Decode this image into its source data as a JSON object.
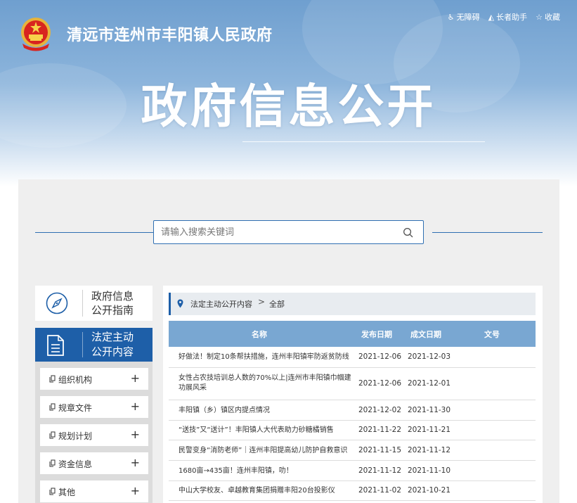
{
  "header": {
    "site_title": "清远市连州市丰阳镇人民政府",
    "links": [
      {
        "label": "无障碍",
        "icon": "accessibility-icon"
      },
      {
        "label": "长者助手",
        "icon": "elder-assistant-icon"
      },
      {
        "label": "收藏",
        "icon": "star-icon"
      }
    ],
    "banner_title": "政府信息公开"
  },
  "search": {
    "placeholder": "请输入搜索关键词",
    "icon": "search-icon"
  },
  "sidebar": {
    "guide": {
      "line1": "政府信息",
      "line2": "公开指南",
      "icon": "compass-icon"
    },
    "active": {
      "line1": "法定主动",
      "line2": "公开内容",
      "icon": "document-icon"
    },
    "items": [
      {
        "label": "组织机构"
      },
      {
        "label": "规章文件"
      },
      {
        "label": "规划计划"
      },
      {
        "label": "资金信息"
      },
      {
        "label": "其他"
      }
    ],
    "expand_symbol": "+"
  },
  "breadcrumb": {
    "section": "法定主动公开内容",
    "separator": ">",
    "current": "全部"
  },
  "table": {
    "headers": {
      "name": "名称",
      "publish_date": "发布日期",
      "doc_date": "成文日期",
      "doc_no": "文号"
    },
    "rows": [
      {
        "name": "好做法！制定10条帮扶措施，连州丰阳镇牢防返贫防线",
        "publish_date": "2021-12-06",
        "doc_date": "2021-12-03"
      },
      {
        "name": "女性占农技培训总人数的70%以上|连州市丰阳镇巾帼建功展风采",
        "publish_date": "2021-12-06",
        "doc_date": "2021-12-01"
      },
      {
        "name": "丰阳镇（乡）镇区内提点情况",
        "publish_date": "2021-12-02",
        "doc_date": "2021-11-30"
      },
      {
        "name": "“送技”又“送计”！丰阳镇人大代表助力砂糖橘销售",
        "publish_date": "2021-11-22",
        "doc_date": "2021-11-21"
      },
      {
        "name": "民警变身“消防老师”｜连州丰阳提高幼儿防护自救意识",
        "publish_date": "2021-11-15",
        "doc_date": "2021-11-12"
      },
      {
        "name": "1680亩→435亩！连州丰阳镇，叻！",
        "publish_date": "2021-11-12",
        "doc_date": "2021-11-10"
      },
      {
        "name": "中山大学校友、卓越教育集团捐赠丰阳20台投影仪",
        "publish_date": "2021-11-02",
        "doc_date": "2021-10-21"
      }
    ]
  },
  "colors": {
    "primary": "#1e5fa8",
    "table_header": "#79a7d2",
    "panel_bg": "#efefef"
  }
}
